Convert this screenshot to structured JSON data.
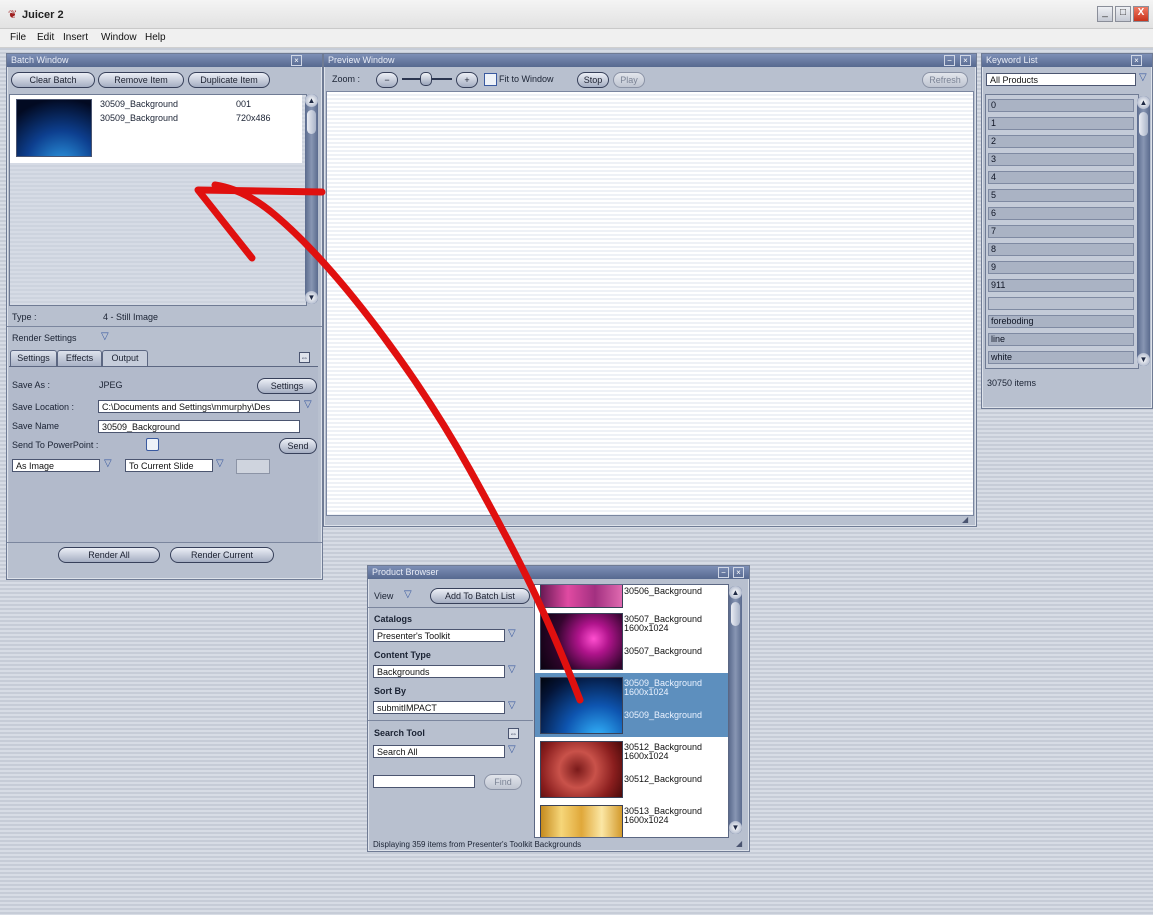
{
  "window": {
    "title": "Juicer 2",
    "controls": {
      "minimize": "_",
      "maximize": "□",
      "close": "X"
    }
  },
  "menu": [
    "File",
    "Edit",
    "Insert",
    "Window",
    "Help"
  ],
  "batch_window": {
    "title": "Batch Window",
    "buttons": [
      "Clear Batch",
      "Remove Item",
      "Duplicate Item"
    ],
    "items": [
      {
        "name": "30509_Background",
        "value": "001"
      },
      {
        "name": "30509_Background",
        "value": "720x486"
      }
    ],
    "type_label": "Type :",
    "type_value": "4 - Still Image",
    "render_settings_label": "Render Settings",
    "tabs": [
      "Settings",
      "Effects",
      "Output"
    ],
    "active_tab": "Output",
    "save_as_label": "Save As :",
    "save_as_value": "JPEG",
    "settings_button": "Settings",
    "save_location_label": "Save Location :",
    "save_location_value": "C:\\Documents and Settings\\mmurphy\\Des",
    "save_name_label": "Save Name",
    "save_name_value": "30509_Background",
    "send_to_ppt_label": "Send To PowerPoint :",
    "send_button": "Send",
    "as_image_value": "As Image",
    "to_slide_value": "To Current Slide",
    "render_all": "Render All",
    "render_current": "Render Current"
  },
  "preview_window": {
    "title": "Preview Window",
    "zoom_label": "Zoom :",
    "zoom_out": "−",
    "zoom_in": "+",
    "fit_to_window_label": "Fit to Window",
    "fit_to_window_checked": false,
    "stop_button": "Stop",
    "play_button": "Play",
    "refresh_button": "Refresh"
  },
  "keyword_list": {
    "title": "Keyword List",
    "filter_value": "All Products",
    "items": [
      "0",
      "1",
      "2",
      "3",
      "4",
      "5",
      "6",
      "7",
      "8",
      "9",
      "911",
      "",
      "foreboding",
      "line",
      "white"
    ],
    "count_text": "30750 items"
  },
  "product_browser": {
    "title": "Product Browser",
    "view_label": "View",
    "add_button": "Add To Batch List",
    "catalogs_label": "Catalogs",
    "catalog_value": "Presenter's Toolkit",
    "content_type_label": "Content Type",
    "content_type_value": "Backgrounds",
    "sort_by_label": "Sort By",
    "sort_by_value": "submitIMPACT",
    "search_tool_label": "Search Tool",
    "search_scope_value": "Search All",
    "search_input_value": "",
    "search_button": "Find",
    "items": [
      {
        "title": "30506_Background",
        "size": "",
        "subtitle": ""
      },
      {
        "title": "30507_Background",
        "size": "1600x1024",
        "subtitle": "30507_Background"
      },
      {
        "title": "30509_Background",
        "size": "1600x1024",
        "subtitle": "30509_Background"
      },
      {
        "title": "30512_Background",
        "size": "1600x1024",
        "subtitle": "30512_Background"
      },
      {
        "title": "30513_Background",
        "size": "1600x1024",
        "subtitle": ""
      }
    ],
    "selected_index": 2,
    "status_text": "Displaying 359 items from Presenter's Toolkit Backgrounds"
  },
  "colors": {
    "panel": "#b8c0cf",
    "panel_header": "#56698f",
    "selection": "#5d8fbe",
    "annotation_arrow": "#e0100f"
  }
}
